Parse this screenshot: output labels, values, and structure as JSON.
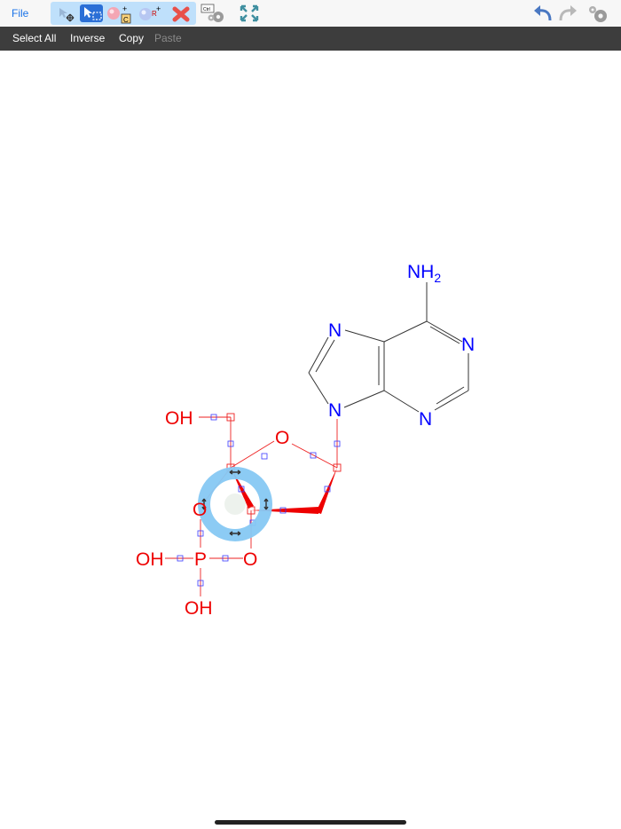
{
  "toolbar": {
    "file_label": "File",
    "tools": [
      "lasso-move-tool",
      "rect-select-tool",
      "add-atom-tool",
      "add-group-tool",
      "erase-tool"
    ],
    "selected_tool": "rect-select-tool",
    "icons": [
      "ctrl-settings-icon",
      "fit-screen-icon",
      "undo-icon",
      "redo-icon",
      "settings-icon"
    ]
  },
  "actionbar": {
    "select_all": "Select All",
    "inverse": "Inverse",
    "copy": "Copy",
    "paste": "Paste"
  },
  "molecule": {
    "labels": {
      "nh2": "NH",
      "nh2_sub": "2",
      "n7": "N",
      "n1": "N",
      "n9": "N",
      "n3": "N",
      "o_ring": "O",
      "oh_top": "OH",
      "o_left": "O",
      "p": "P",
      "o_right": "O",
      "oh_left": "OH",
      "oh_bottom": "OH"
    },
    "colors": {
      "adenine": "#0000ff",
      "sugar_phosphate": "#ee0000",
      "selection_handle": "#1e90ff",
      "selection_box": "#3a3aff"
    }
  },
  "colors": {
    "toolbar_bg": "#f7f7f7",
    "actionbar_bg": "#3d3d3d",
    "accent": "#1a73e8"
  }
}
